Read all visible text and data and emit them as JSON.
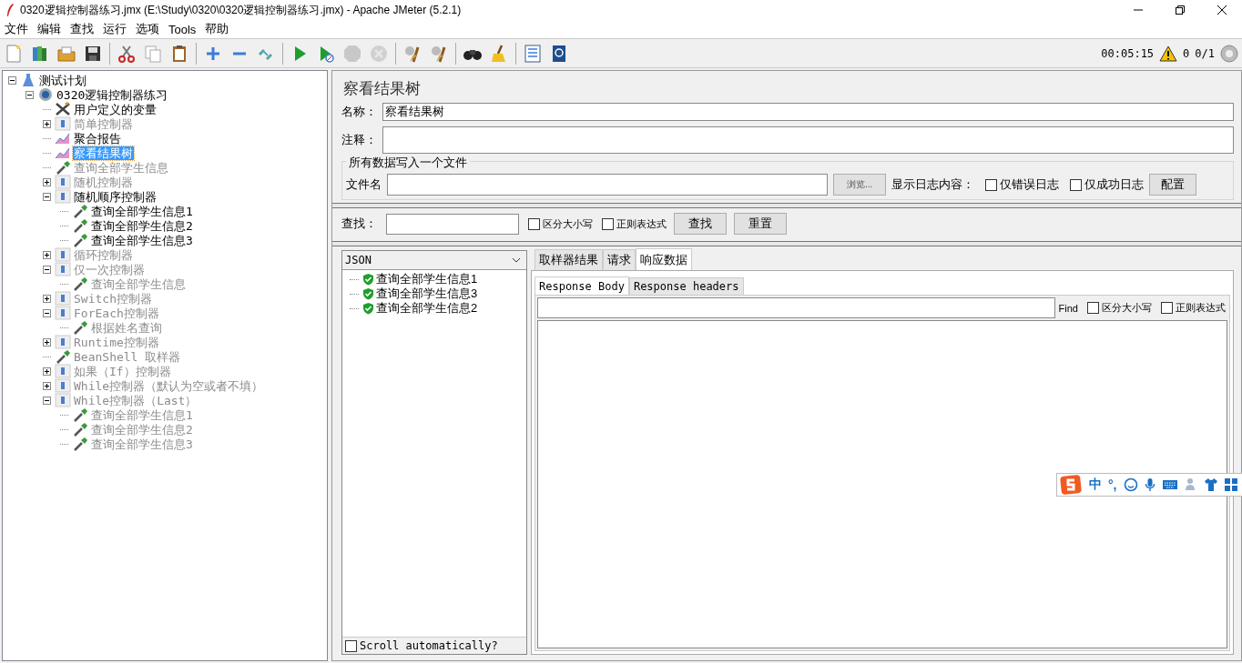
{
  "window": {
    "title": "0320逻辑控制器练习.jmx (E:\\Study\\0320\\0320逻辑控制器练习.jmx) - Apache JMeter (5.2.1)"
  },
  "menu": [
    {
      "label": "文件"
    },
    {
      "label": "编辑"
    },
    {
      "label": "查找"
    },
    {
      "label": "运行"
    },
    {
      "label": "选项"
    },
    {
      "label": "Tools"
    },
    {
      "label": "帮助"
    }
  ],
  "toolbar": [
    {
      "kind": "new",
      "disabled": false
    },
    {
      "kind": "templates",
      "disabled": false
    },
    {
      "kind": "open",
      "disabled": false
    },
    {
      "kind": "save",
      "disabled": false
    },
    {
      "kind": "sep"
    },
    {
      "kind": "cut",
      "disabled": false
    },
    {
      "kind": "copy",
      "disabled": false
    },
    {
      "kind": "paste",
      "disabled": false
    },
    {
      "kind": "sep"
    },
    {
      "kind": "expand",
      "disabled": false
    },
    {
      "kind": "collapse",
      "disabled": false
    },
    {
      "kind": "toggle",
      "disabled": false
    },
    {
      "kind": "sep"
    },
    {
      "kind": "start",
      "disabled": false
    },
    {
      "kind": "start-no-pause",
      "disabled": false
    },
    {
      "kind": "stop",
      "disabled": true
    },
    {
      "kind": "shutdown",
      "disabled": true
    },
    {
      "kind": "sep"
    },
    {
      "kind": "clear",
      "disabled": false
    },
    {
      "kind": "clear-all",
      "disabled": false
    },
    {
      "kind": "sep"
    },
    {
      "kind": "search",
      "disabled": false
    },
    {
      "kind": "reset-search",
      "disabled": false
    },
    {
      "kind": "sep"
    },
    {
      "kind": "function-helper",
      "disabled": false
    },
    {
      "kind": "help",
      "disabled": false
    }
  ],
  "status": {
    "elapsed": "00:05:15",
    "errors": "0",
    "threads": "0/1"
  },
  "tree": [
    {
      "label": "测试计划",
      "kind": "plan",
      "disabled": false,
      "selected": false,
      "expanded": true,
      "children": [
        {
          "label": "0320逻辑控制器练习",
          "kind": "thread",
          "disabled": false,
          "selected": false,
          "expanded": true,
          "children": [
            {
              "label": "用户定义的变量",
              "kind": "config",
              "disabled": false,
              "selected": false
            },
            {
              "label": "简单控制器",
              "kind": "controller",
              "disabled": true,
              "selected": false,
              "expanded": false
            },
            {
              "label": "聚合报告",
              "kind": "listener",
              "disabled": false,
              "selected": false
            },
            {
              "label": "察看结果树",
              "kind": "listener",
              "disabled": false,
              "selected": true
            },
            {
              "label": "查询全部学生信息",
              "kind": "sampler",
              "disabled": true,
              "selected": false
            },
            {
              "label": "随机控制器",
              "kind": "controller",
              "disabled": true,
              "selected": false,
              "expanded": false
            },
            {
              "label": "随机顺序控制器",
              "kind": "controller",
              "disabled": false,
              "selected": false,
              "expanded": true,
              "children": [
                {
                  "label": "查询全部学生信息1",
                  "kind": "sampler",
                  "disabled": false,
                  "selected": false
                },
                {
                  "label": "查询全部学生信息2",
                  "kind": "sampler",
                  "disabled": false,
                  "selected": false
                },
                {
                  "label": "查询全部学生信息3",
                  "kind": "sampler",
                  "disabled": false,
                  "selected": false
                }
              ]
            },
            {
              "label": "循环控制器",
              "kind": "controller",
              "disabled": true,
              "selected": false,
              "expanded": false
            },
            {
              "label": "仅一次控制器",
              "kind": "controller",
              "disabled": true,
              "selected": false,
              "expanded": true,
              "children": [
                {
                  "label": "查询全部学生信息",
                  "kind": "sampler",
                  "disabled": true,
                  "selected": false
                }
              ]
            },
            {
              "label": "Switch控制器",
              "kind": "controller",
              "disabled": true,
              "selected": false,
              "expanded": false
            },
            {
              "label": "ForEach控制器",
              "kind": "controller",
              "disabled": true,
              "selected": false,
              "expanded": true,
              "children": [
                {
                  "label": "根据姓名查询",
                  "kind": "sampler",
                  "disabled": true,
                  "selected": false
                }
              ]
            },
            {
              "label": "Runtime控制器",
              "kind": "controller",
              "disabled": true,
              "selected": false,
              "expanded": false
            },
            {
              "label": "BeanShell 取样器",
              "kind": "sampler",
              "disabled": true,
              "selected": false
            },
            {
              "label": "如果（If）控制器",
              "kind": "controller",
              "disabled": true,
              "selected": false,
              "expanded": false
            },
            {
              "label": "While控制器（默认为空或者不填）",
              "kind": "controller",
              "disabled": true,
              "selected": false,
              "expanded": false
            },
            {
              "label": "While控制器（Last）",
              "kind": "controller",
              "disabled": true,
              "selected": false,
              "expanded": true,
              "children": [
                {
                  "label": "查询全部学生信息1",
                  "kind": "sampler",
                  "disabled": true,
                  "selected": false
                },
                {
                  "label": "查询全部学生信息2",
                  "kind": "sampler",
                  "disabled": true,
                  "selected": false
                },
                {
                  "label": "查询全部学生信息3",
                  "kind": "sampler",
                  "disabled": true,
                  "selected": false
                }
              ]
            }
          ]
        }
      ]
    }
  ],
  "editor": {
    "title": "察看结果树",
    "name_label": "名称：",
    "name_value": "察看结果树",
    "comment_label": "注释：",
    "file_group": {
      "legend": "所有数据写入一个文件",
      "file_label": "文件名",
      "browse": "浏览...",
      "log_label": "显示日志内容：",
      "options": [
        {
          "label": "仅错误日志",
          "checked": false
        },
        {
          "label": "仅成功日志",
          "checked": false
        }
      ],
      "configure": "配置"
    },
    "search": {
      "label": "查找：",
      "options": [
        {
          "label": "区分大小写",
          "checked": false
        },
        {
          "label": "正则表达式",
          "checked": false
        }
      ],
      "buttons": [
        "查找",
        "重置"
      ]
    },
    "results": {
      "renderer": "JSON",
      "items": [
        {
          "label": "查询全部学生信息1",
          "success": true
        },
        {
          "label": "查询全部学生信息3",
          "success": true
        },
        {
          "label": "查询全部学生信息2",
          "success": true
        }
      ],
      "scroll_auto": {
        "label": "Scroll automatically?",
        "checked": false
      },
      "tabs": [
        {
          "label": "取样器结果",
          "selected": false
        },
        {
          "label": "请求",
          "selected": false
        },
        {
          "label": "响应数据",
          "selected": true
        }
      ],
      "subtabs": [
        {
          "label": "Response Body",
          "selected": true
        },
        {
          "label": "Response headers",
          "selected": false
        }
      ],
      "find_label": "Find",
      "find_options": [
        {
          "label": "区分大小写",
          "checked": false
        },
        {
          "label": "正则表达式",
          "checked": false
        }
      ]
    }
  },
  "ime": {
    "mode": "中",
    "punct": "°,"
  }
}
